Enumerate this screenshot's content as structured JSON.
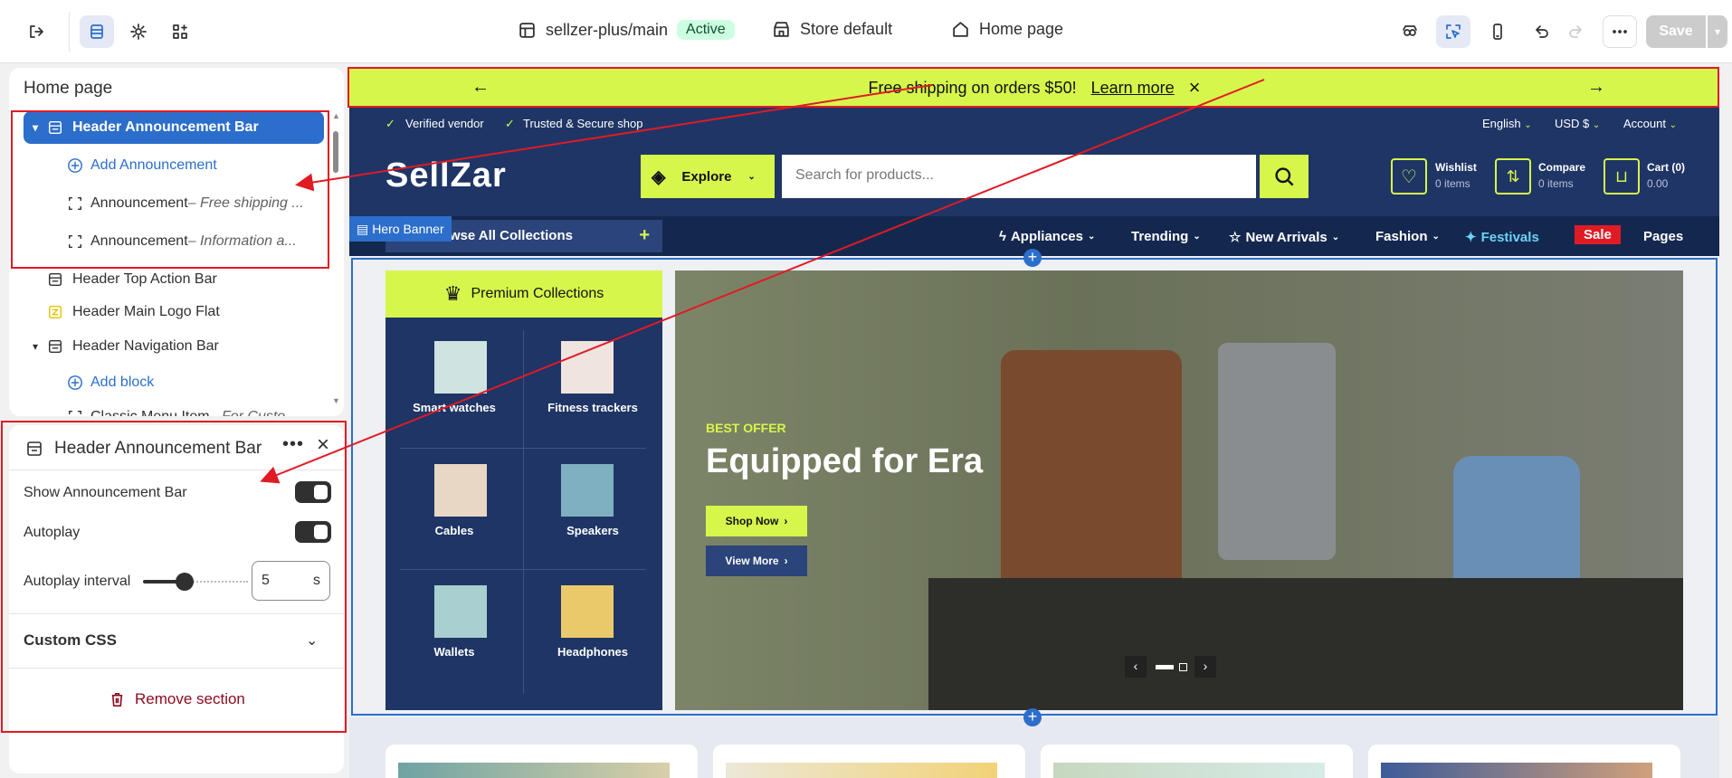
{
  "topbar": {
    "theme_name": "sellzer-plus/main",
    "theme_status": "Active",
    "store": "Store default",
    "page": "Home page",
    "save": "Save"
  },
  "tree": {
    "title": "Home page",
    "items": [
      {
        "label": "Header Announcement Bar"
      },
      {
        "label": "Add Announcement"
      },
      {
        "label": "Announcement",
        "sub": " – Free shipping ..."
      },
      {
        "label": "Announcement",
        "sub": " – Information a..."
      },
      {
        "label": "Header Top Action Bar"
      },
      {
        "label": "Header Main Logo Flat"
      },
      {
        "label": "Header Navigation Bar"
      },
      {
        "label": "Add block"
      },
      {
        "label": "Classic Menu Item",
        "sub": " – For Custo..."
      }
    ]
  },
  "settings": {
    "title": "Header Announcement Bar",
    "show_label": "Show Announcement Bar",
    "show_on": true,
    "autoplay_label": "Autoplay",
    "autoplay_on": true,
    "interval_label": "Autoplay interval",
    "interval_value": "5",
    "interval_unit": "s",
    "interval_fraction": 0.4,
    "custom_css": "Custom CSS",
    "remove": "Remove section"
  },
  "preview": {
    "announcement": {
      "text": "Free shipping on orders $50!",
      "link": "Learn more"
    },
    "topbar": {
      "left": [
        "Verified vendor",
        "Trusted & Secure shop"
      ],
      "lang": "English",
      "currency": "USD $",
      "account": "Account"
    },
    "logo": "SellZar",
    "explore": "Explore",
    "search_placeholder": "Search for products...",
    "wishlist": {
      "label": "Wishlist",
      "sub": "0 items"
    },
    "compare": {
      "label": "Compare",
      "sub": "0 items"
    },
    "cart": {
      "label": "Cart (0)",
      "sub": "0.00"
    },
    "browse": "Browse All Collections",
    "section_tag": "Hero Banner",
    "nav": [
      "Appliances",
      "Trending",
      "New Arrivals",
      "Fashion",
      "Festivals",
      "Sale",
      "Pages"
    ],
    "collections_title": "Premium Collections",
    "collections": [
      "Smart watches",
      "Fitness trackers",
      "Cables",
      "Speakers",
      "Wallets",
      "Headphones"
    ],
    "hero": {
      "kicker": "BEST OFFER",
      "title": "Equipped for Era",
      "btn1": "Shop Now",
      "btn2": "View More"
    }
  },
  "colors": {
    "accent": "#2c6ecb",
    "brand_lime": "#d7f64b",
    "navy": "#1f3566",
    "danger": "#8e0b21",
    "annotation_red": "#e01b24"
  }
}
